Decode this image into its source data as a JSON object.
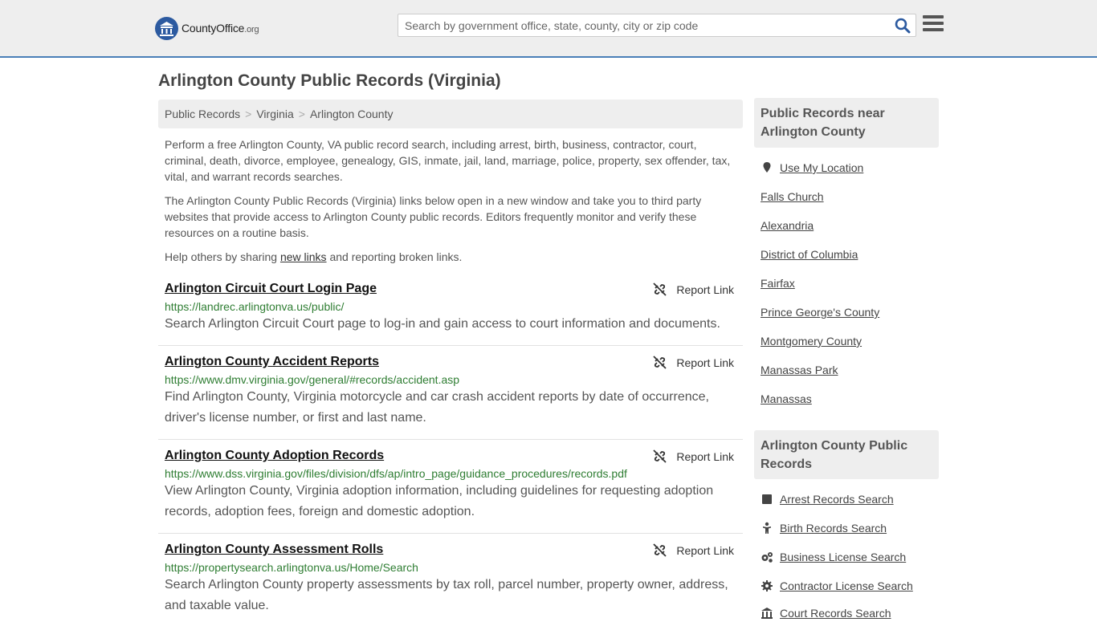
{
  "header": {
    "logo_main": "CountyOffice",
    "logo_suffix": ".org",
    "search_placeholder": "Search by government office, state, county, city or zip code"
  },
  "page_title": "Arlington County Public Records (Virginia)",
  "breadcrumb": [
    "Public Records",
    "Virginia",
    "Arlington County"
  ],
  "intro": {
    "p1": "Perform a free Arlington County, VA public record search, including arrest, birth, business, contractor, court, criminal, death, divorce, employee, genealogy, GIS, inmate, jail, land, marriage, police, property, sex offender, tax, vital, and warrant records searches.",
    "p2": "The Arlington County Public Records (Virginia) links below open in a new window and take you to third party websites that provide access to Arlington County public records. Editors frequently monitor and verify these resources on a routine basis.",
    "p3_before": "Help others by sharing ",
    "p3_link": "new links",
    "p3_after": " and reporting broken links."
  },
  "report_label": "Report Link",
  "records": [
    {
      "title": "Arlington Circuit Court Login Page",
      "url": "https://landrec.arlingtonva.us/public/",
      "desc": "Search Arlington Circuit Court page to log-in and gain access to court information and documents."
    },
    {
      "title": "Arlington County Accident Reports",
      "url": "https://www.dmv.virginia.gov/general/#records/accident.asp",
      "desc": "Find Arlington County, Virginia motorcycle and car crash accident reports by date of occurrence, driver's license number, or first and last name."
    },
    {
      "title": "Arlington County Adoption Records",
      "url": "https://www.dss.virginia.gov/files/division/dfs/ap/intro_page/guidance_procedures/records.pdf",
      "desc": "View Arlington County, Virginia adoption information, including guidelines for requesting adoption records, adoption fees, foreign and domestic adoption."
    },
    {
      "title": "Arlington County Assessment Rolls",
      "url": "https://propertysearch.arlingtonva.us/Home/Search",
      "desc": "Search Arlington County property assessments by tax roll, parcel number, property owner, address, and taxable value."
    }
  ],
  "sidebar": {
    "near_heading": "Public Records near Arlington County",
    "use_location": "Use My Location",
    "near_links": [
      "Falls Church",
      "Alexandria",
      "District of Columbia",
      "Fairfax",
      "Prince George's County",
      "Montgomery County",
      "Manassas Park",
      "Manassas"
    ],
    "county_heading": "Arlington County Public Records",
    "county_links": [
      {
        "label": "Arrest Records Search",
        "icon": "square-icon"
      },
      {
        "label": "Birth Records Search",
        "icon": "baby-icon"
      },
      {
        "label": "Business License Search",
        "icon": "gears-icon"
      },
      {
        "label": "Contractor License Search",
        "icon": "gear-icon"
      },
      {
        "label": "Court Records Search",
        "icon": "courthouse-icon"
      }
    ]
  },
  "colors": {
    "accent": "#4a7fb8",
    "url_green": "#2e7d32",
    "panel_gray": "#eeeeee"
  }
}
